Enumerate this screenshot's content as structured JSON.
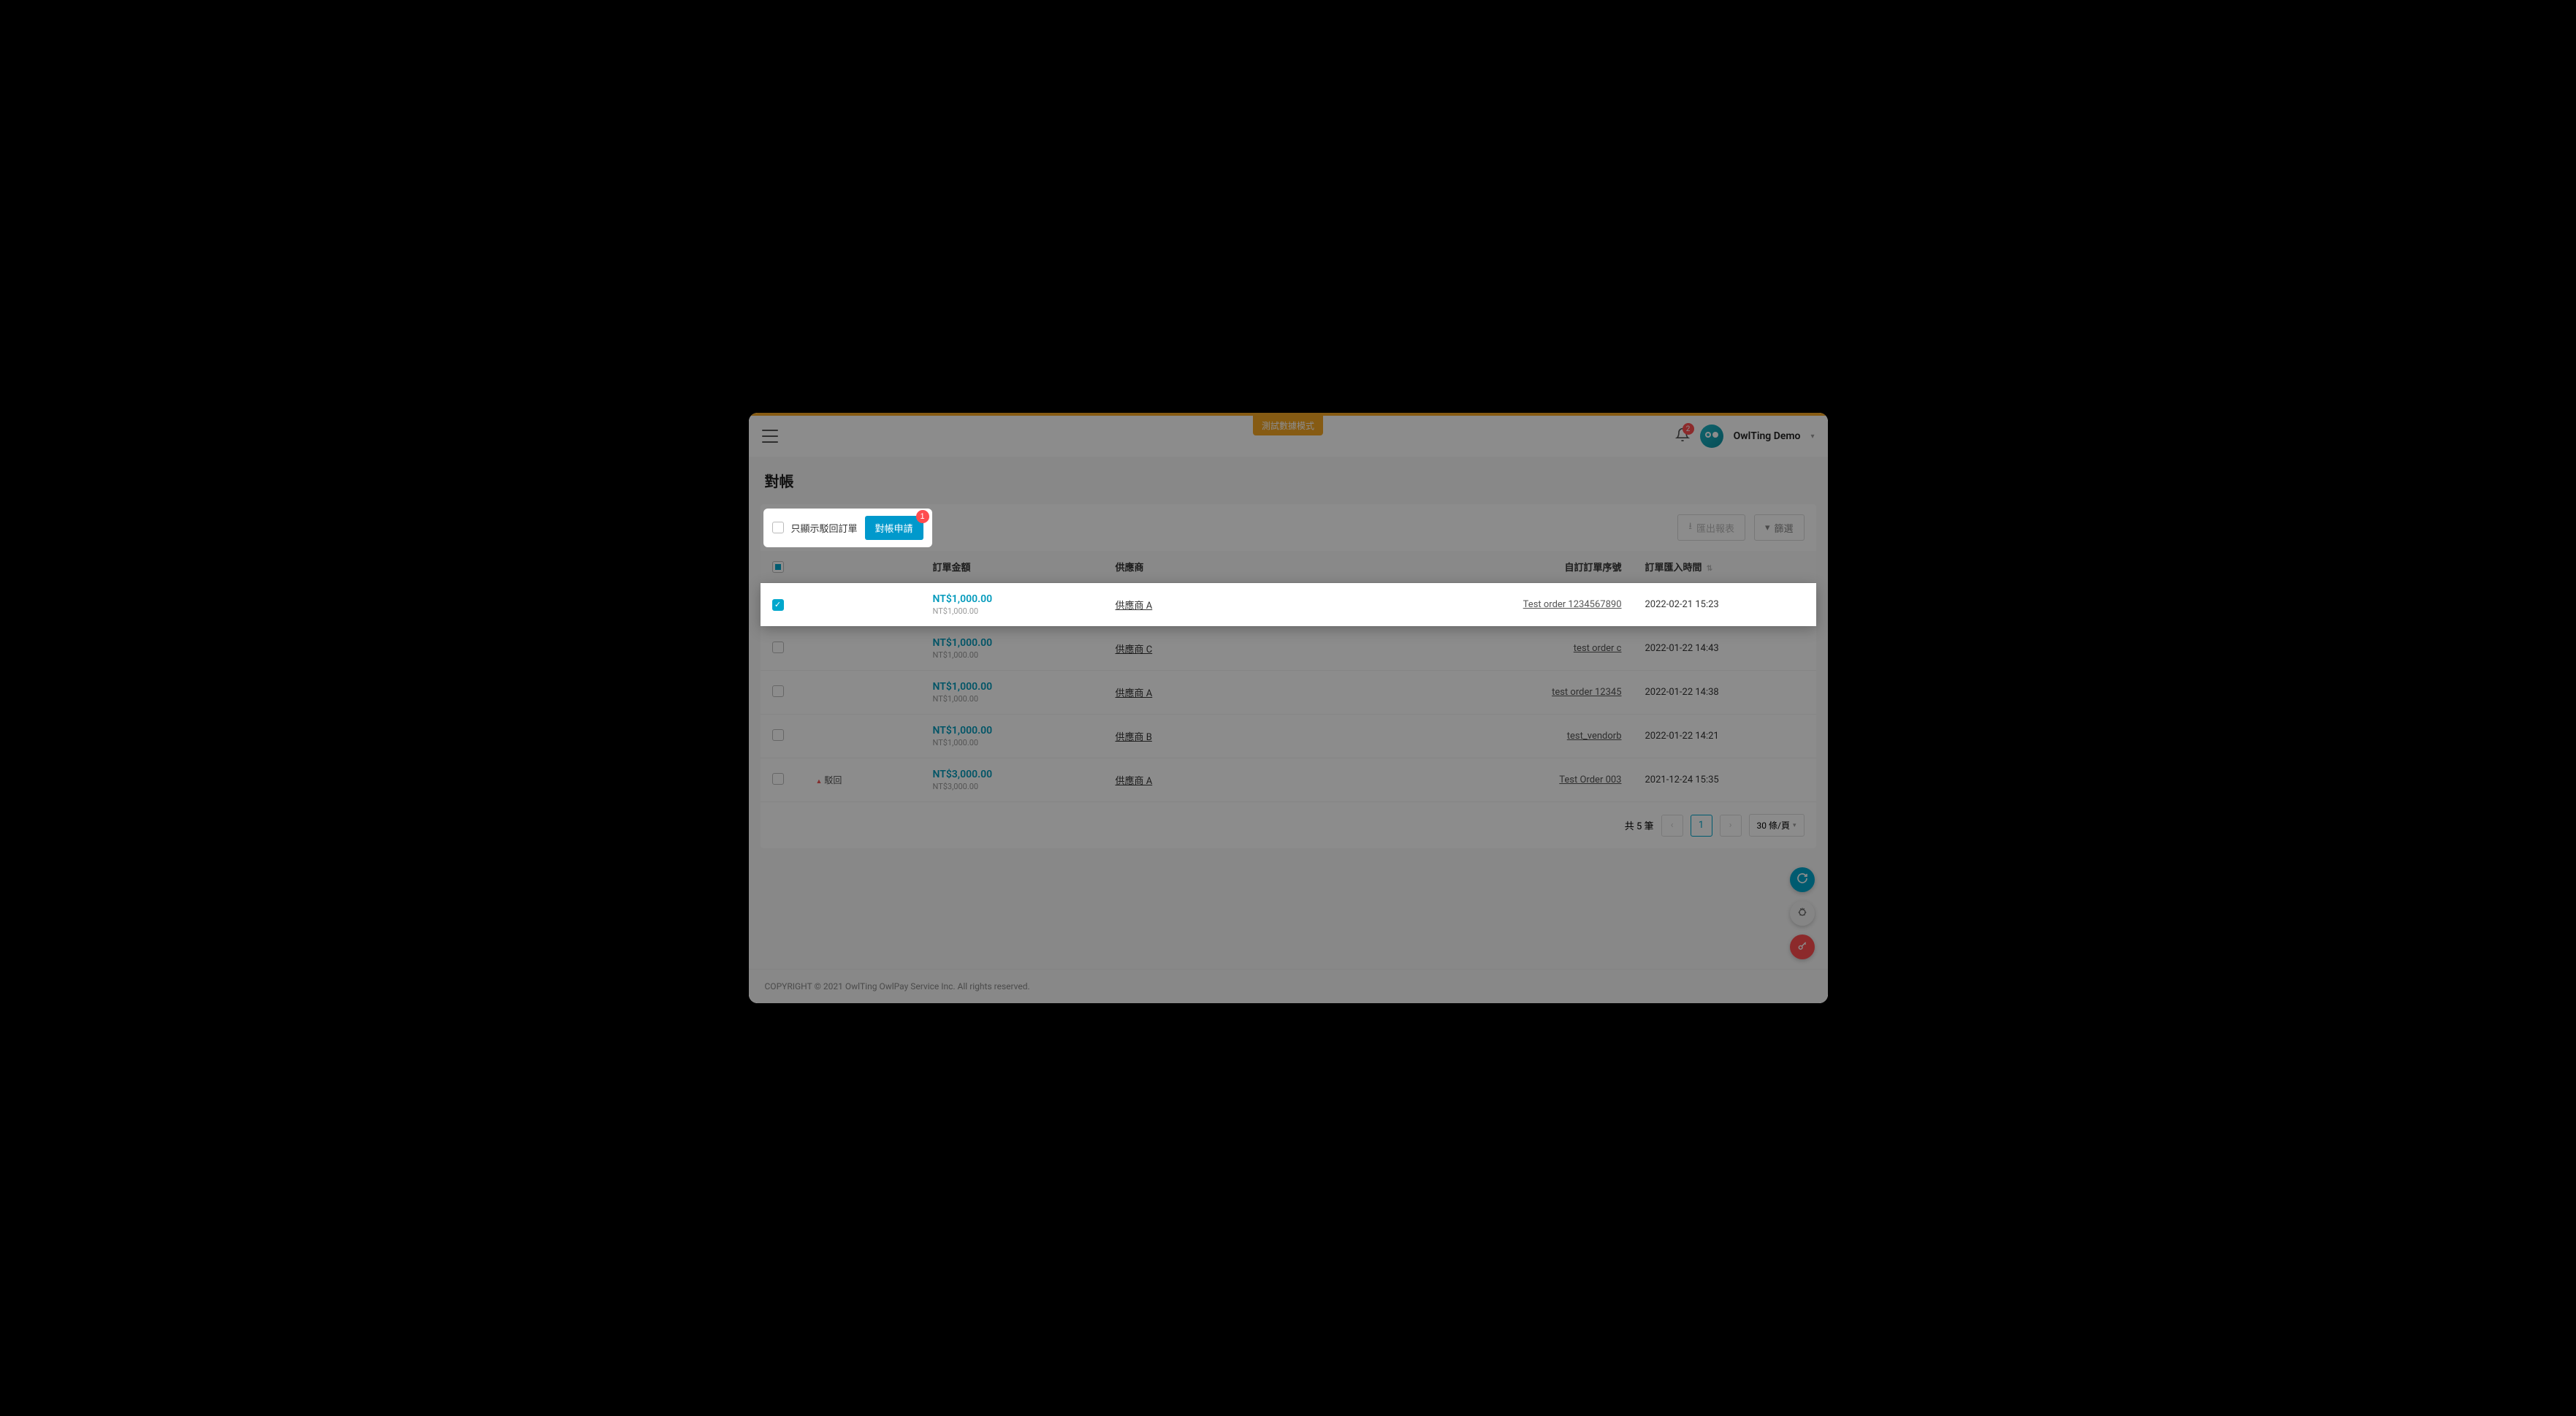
{
  "test_mode_label": "測試數據模式",
  "header": {
    "notification_count": "2",
    "username": "OwlTing Demo"
  },
  "page_title": "對帳",
  "toolbar": {
    "only_rejected_label": "只顯示駁回訂單",
    "apply_label": "對帳申請",
    "apply_badge": "1",
    "export_label": "匯出報表",
    "filter_label": "篩選"
  },
  "columns": {
    "amount": "訂單金額",
    "vendor": "供應商",
    "order_no": "自訂訂單序號",
    "import_time": "訂單匯入時間"
  },
  "rows": [
    {
      "checked": true,
      "status_rejected": false,
      "amount_main": "NT$1,000.00",
      "amount_sub": "NT$1,000.00",
      "vendor": "供應商 A",
      "order_no": "Test order 1234567890",
      "time": "2022-02-21 15:23",
      "highlight": true
    },
    {
      "checked": false,
      "status_rejected": false,
      "amount_main": "NT$1,000.00",
      "amount_sub": "NT$1,000.00",
      "vendor": "供應商 C",
      "order_no": "test order c",
      "time": "2022-01-22 14:43",
      "highlight": false
    },
    {
      "checked": false,
      "status_rejected": false,
      "amount_main": "NT$1,000.00",
      "amount_sub": "NT$1,000.00",
      "vendor": "供應商 A",
      "order_no": "test order 12345",
      "time": "2022-01-22 14:38",
      "highlight": false
    },
    {
      "checked": false,
      "status_rejected": false,
      "amount_main": "NT$1,000.00",
      "amount_sub": "NT$1,000.00",
      "vendor": "供應商 B",
      "order_no": "test_vendorb",
      "time": "2022-01-22 14:21",
      "highlight": false
    },
    {
      "checked": false,
      "status_rejected": true,
      "status_label": "駁回",
      "amount_main": "NT$3,000.00",
      "amount_sub": "NT$3,000.00",
      "vendor": "供應商 A",
      "order_no": "Test Order 003",
      "time": "2021-12-24 15:35",
      "highlight": false
    }
  ],
  "pagination": {
    "total_label": "共 5 筆",
    "current_page": "1",
    "page_size_label": "30 條/頁"
  },
  "footer": "COPYRIGHT © 2021 OwlTing OwlPay Service Inc. All rights reserved."
}
